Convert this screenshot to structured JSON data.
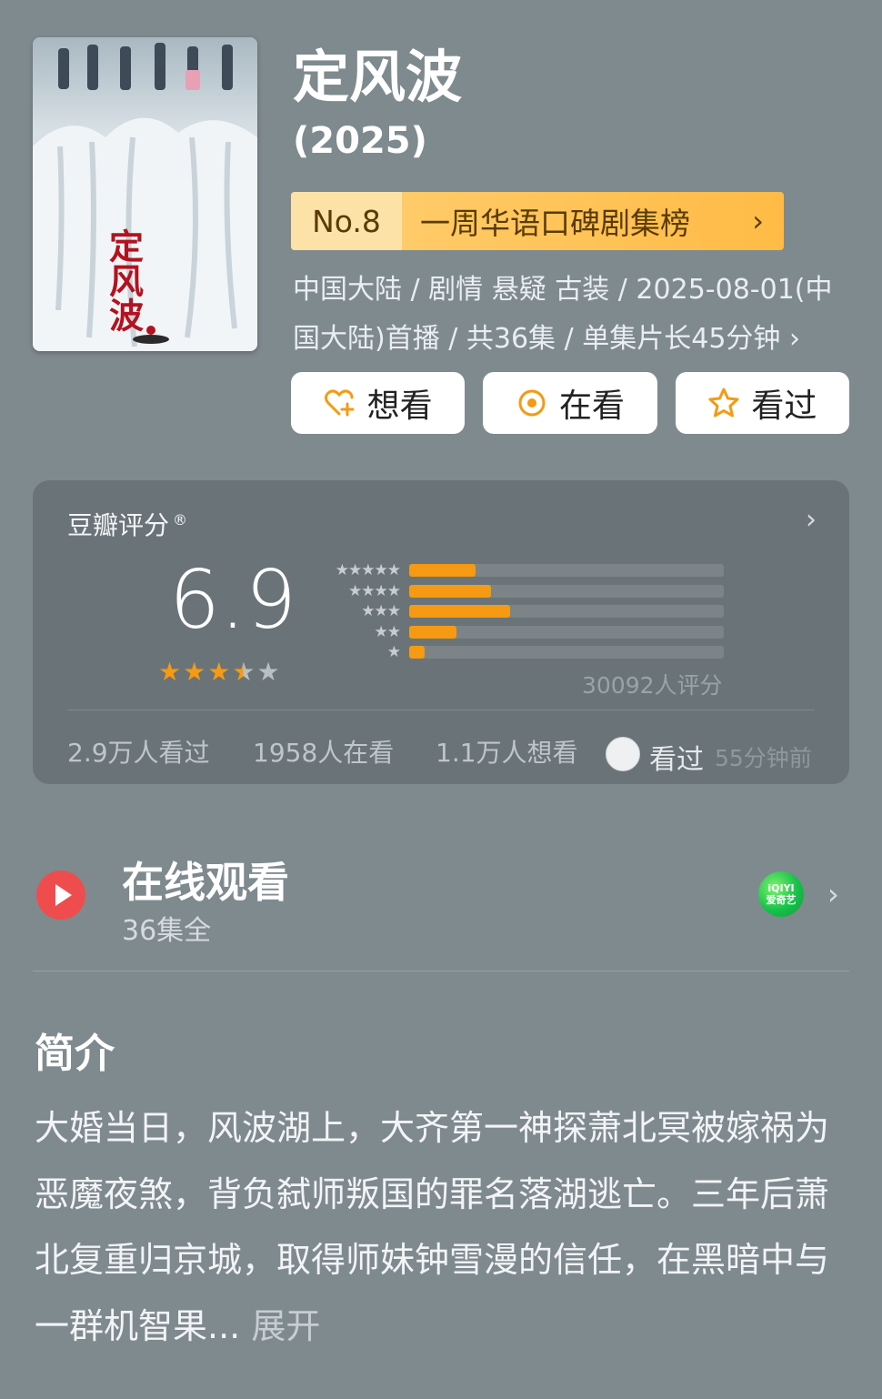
{
  "show": {
    "title": "定风波",
    "year": "(2025)",
    "rank_no": "No.8",
    "rank_list": "一周华语口碑剧集榜",
    "info": "中国大陆 / 剧情 悬疑 古装 / 2025-08-01(中国大陆)首播 / 共36集 / 单集片长45分钟 ›",
    "poster_title": "定风波"
  },
  "actions": [
    {
      "label": "想看",
      "icon": "heart-plus-icon"
    },
    {
      "label": "在看",
      "icon": "target-icon"
    },
    {
      "label": "看过",
      "icon": "star-outline-icon"
    }
  ],
  "rating": {
    "source_label": "豆瓣评分",
    "source_mark": "®",
    "score": "6.9",
    "stars_value": 3.5,
    "distribution": [
      {
        "stars": "★★★★★",
        "fraction": 0.21
      },
      {
        "stars": "★★★★",
        "fraction": 0.26
      },
      {
        "stars": "★★★",
        "fraction": 0.32
      },
      {
        "stars": "★★",
        "fraction": 0.15
      },
      {
        "stars": "★",
        "fraction": 0.05
      }
    ],
    "votes": "30092人评分",
    "watched": "2.9万人看过",
    "watching": "1958人在看",
    "wish": "1.1万人想看",
    "friend_action": "看过",
    "friend_time": "55分钟前"
  },
  "watch": {
    "title": "在线观看",
    "sub": "36集全",
    "platform_top": "iQIYI",
    "platform_bottom": "爱奇艺"
  },
  "synopsis": {
    "title": "简介",
    "text": "大婚当日，风波湖上，大齐第一神探萧北冥被嫁祸为恶魔夜煞，背负弑师叛国的罪名落湖逃亡。三年后萧北复重归京城，取得师妹钟雪漫的信任，在黑暗中与一群机智果...",
    "more": " 展开"
  },
  "colors": {
    "accent": "#f59a12",
    "play": "#ef4d4d",
    "background": "#7f8a8f"
  }
}
